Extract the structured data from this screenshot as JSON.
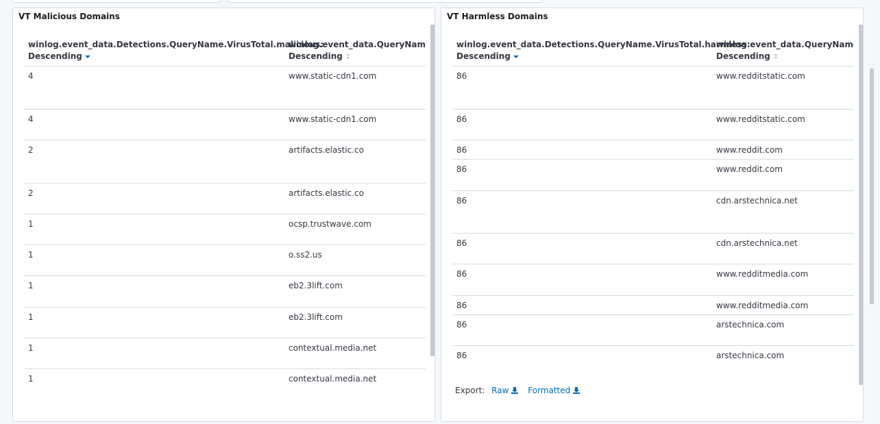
{
  "malicious_panel": {
    "title": "VT Malicious Domains",
    "columns": [
      "winlog.event_data.Detections.QueryName.VirusTotal.malicious:",
      "winlog.event_data.QueryName.keyword:"
    ],
    "sort_label": "Descending",
    "rows": [
      [
        "4",
        "www.static-cdn1.com"
      ],
      [
        "4",
        "www.static-cdn1.com"
      ],
      [
        "2",
        "artifacts.elastic.co"
      ],
      [
        "2",
        "artifacts.elastic.co"
      ],
      [
        "1",
        "ocsp.trustwave.com"
      ],
      [
        "1",
        "o.ss2.us"
      ],
      [
        "1",
        "eb2.3lift.com"
      ],
      [
        "1",
        "eb2.3lift.com"
      ],
      [
        "1",
        "contextual.media.net"
      ],
      [
        "1",
        "contextual.media.net"
      ]
    ]
  },
  "harmless_panel": {
    "title": "VT Harmless Domains",
    "columns": [
      "winlog.event_data.Detections.QueryName.VirusTotal.harmless:",
      "winlog.event_data.QueryName.keyword:"
    ],
    "sort_label": "Descending",
    "rows": [
      [
        "86",
        "www.redditstatic.com"
      ],
      [
        "86",
        "www.redditstatic.com"
      ],
      [
        "86",
        "www.reddit.com"
      ],
      [
        "86",
        "www.reddit.com"
      ],
      [
        "86",
        "cdn.arstechnica.net"
      ],
      [
        "86",
        "cdn.arstechnica.net"
      ],
      [
        "86",
        "www.redditmedia.com"
      ],
      [
        "86",
        "www.redditmedia.com"
      ],
      [
        "86",
        "arstechnica.com"
      ],
      [
        "86",
        "arstechnica.com"
      ]
    ],
    "export": {
      "label": "Export:",
      "raw": "Raw",
      "formatted": "Formatted"
    }
  },
  "icons": {
    "sort_active": "sort-down-icon",
    "sort_inactive": "sortable-icon",
    "download": "download-icon"
  },
  "colors": {
    "link": "#006bb4",
    "border": "#d3dae6",
    "background": "#f5f7fa"
  }
}
